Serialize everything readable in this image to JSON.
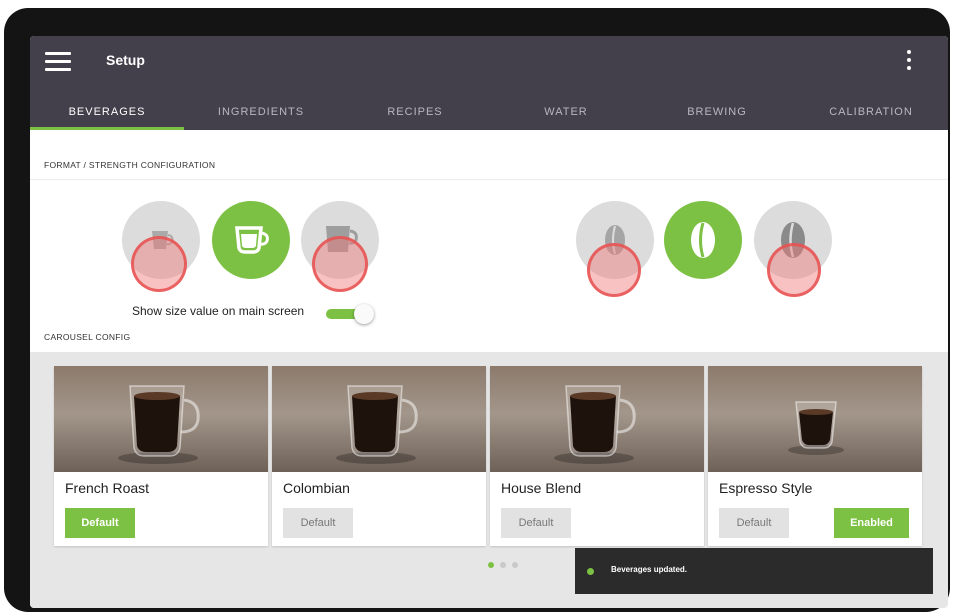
{
  "app": {
    "title": "Setup",
    "menu_icon": "hamburger-menu-icon",
    "overflow_icon": "more-vert-icon"
  },
  "tabs": [
    {
      "label": "BEVERAGES",
      "active": true
    },
    {
      "label": "INGREDIENTS",
      "active": false
    },
    {
      "label": "RECIPES",
      "active": false
    },
    {
      "label": "WATER",
      "active": false
    },
    {
      "label": "BREWING",
      "active": false
    },
    {
      "label": "CALIBRATION",
      "active": false
    }
  ],
  "format_section": {
    "label": "FORMAT / STRENGTH CONFIGURATION",
    "format_options": [
      {
        "icon": "small-cup-icon",
        "selected": false
      },
      {
        "icon": "medium-cup-icon",
        "selected": true
      },
      {
        "icon": "large-cup-icon",
        "selected": false
      }
    ],
    "strength_options": [
      {
        "icon": "light-bean-icon",
        "selected": false
      },
      {
        "icon": "medium-bean-icon",
        "selected": true
      },
      {
        "icon": "dark-bean-icon",
        "selected": false
      }
    ],
    "toggle_label": "Show size value on main screen",
    "toggle_on": true
  },
  "carousel": {
    "label": "CAROUSEL CONFIG",
    "cards": [
      {
        "name": "French Roast",
        "default_label": "Default",
        "is_default": true,
        "enabled_label": ""
      },
      {
        "name": "Colombian",
        "default_label": "Default",
        "is_default": false,
        "enabled_label": ""
      },
      {
        "name": "House Blend",
        "default_label": "Default",
        "is_default": false,
        "enabled_label": ""
      },
      {
        "name": "Espresso Style",
        "default_label": "Default",
        "is_default": false,
        "enabled_label": "Enabled"
      }
    ],
    "page_count": 3,
    "current_page": 1
  },
  "snackbar": {
    "message": "Beverages updated."
  },
  "colors": {
    "accent": "#7cc143",
    "appbar": "#43404b",
    "snackbar": "#2b2b2b"
  }
}
